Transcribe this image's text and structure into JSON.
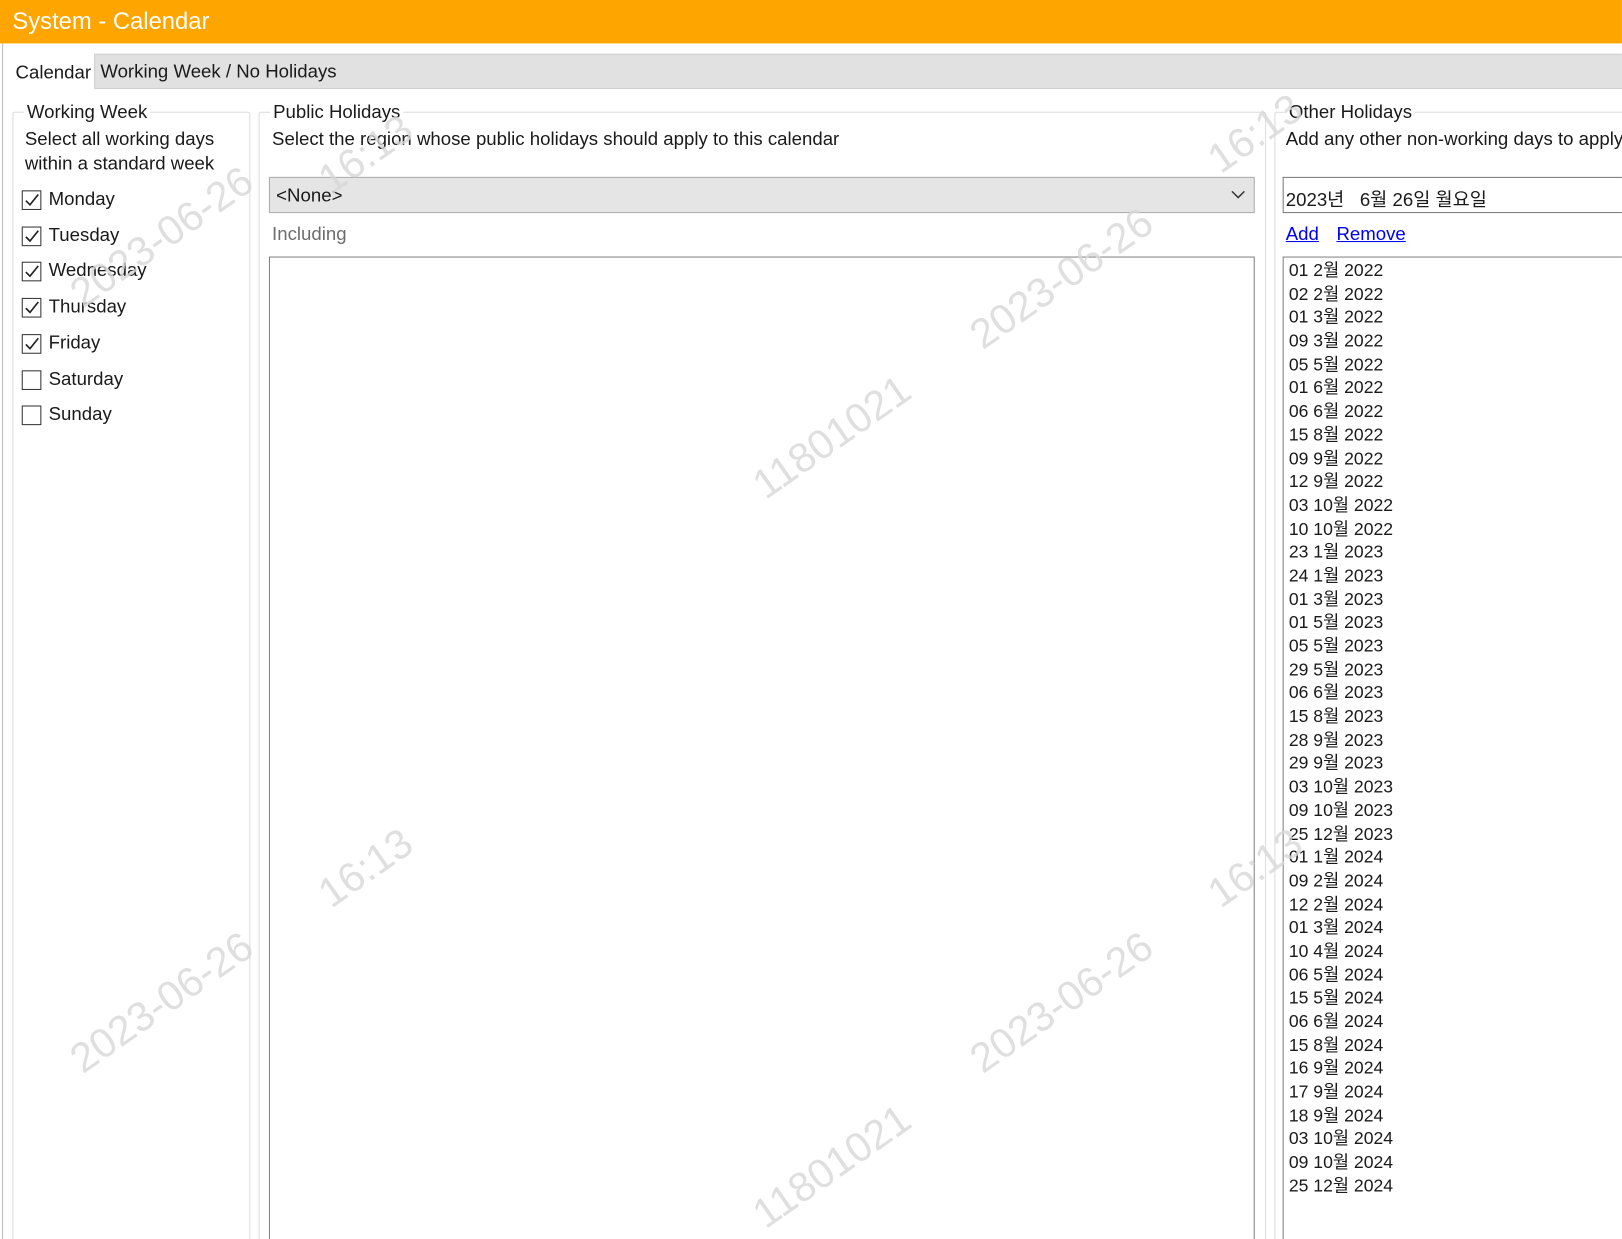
{
  "window": {
    "title": "System - Calendar",
    "accent": "#FFA500"
  },
  "calendar": {
    "label": "Calendar",
    "value": "Working Week / No Holidays"
  },
  "working_week": {
    "title": "Working Week",
    "description_line1": "Select all working days",
    "description_line2": "within a standard week",
    "days": [
      {
        "label": "Monday",
        "checked": true
      },
      {
        "label": "Tuesday",
        "checked": true
      },
      {
        "label": "Wednesday",
        "checked": true
      },
      {
        "label": "Thursday",
        "checked": true
      },
      {
        "label": "Friday",
        "checked": true
      },
      {
        "label": "Saturday",
        "checked": false
      },
      {
        "label": "Sunday",
        "checked": false
      }
    ]
  },
  "public_holidays": {
    "title": "Public Holidays",
    "description": "Select the region whose public holidays should apply to this calendar",
    "region_selected": "<None>",
    "including_label": "Including"
  },
  "other_holidays": {
    "title": "Other Holidays",
    "description": "Add any other non-working days to apply",
    "date_value": "2023년   6월 26일 월요일",
    "add_label": "Add",
    "remove_label": "Remove",
    "dates": [
      "01 2월 2022",
      "02 2월 2022",
      "01 3월 2022",
      "09 3월 2022",
      "05 5월 2022",
      "01 6월 2022",
      "06 6월 2022",
      "15 8월 2022",
      "09 9월 2022",
      "12 9월 2022",
      "03 10월 2022",
      "10 10월 2022",
      "23 1월 2023",
      "24 1월 2023",
      "01 3월 2023",
      "01 5월 2023",
      "05 5월 2023",
      "29 5월 2023",
      "06 6월 2023",
      "15 8월 2023",
      "28 9월 2023",
      "29 9월 2023",
      "03 10월 2023",
      "09 10월 2023",
      "25 12월 2023",
      "01 1월 2024",
      "09 2월 2024",
      "12 2월 2024",
      "01 3월 2024",
      "10 4월 2024",
      "06 5월 2024",
      "15 5월 2024",
      "06 6월 2024",
      "15 8월 2024",
      "16 9월 2024",
      "17 9월 2024",
      "18 9월 2024",
      "03 10월 2024",
      "09 10월 2024",
      "25 12월 2024"
    ]
  },
  "watermark": {
    "date": "2023-06-26",
    "time": "16:13",
    "id": "11801021"
  }
}
